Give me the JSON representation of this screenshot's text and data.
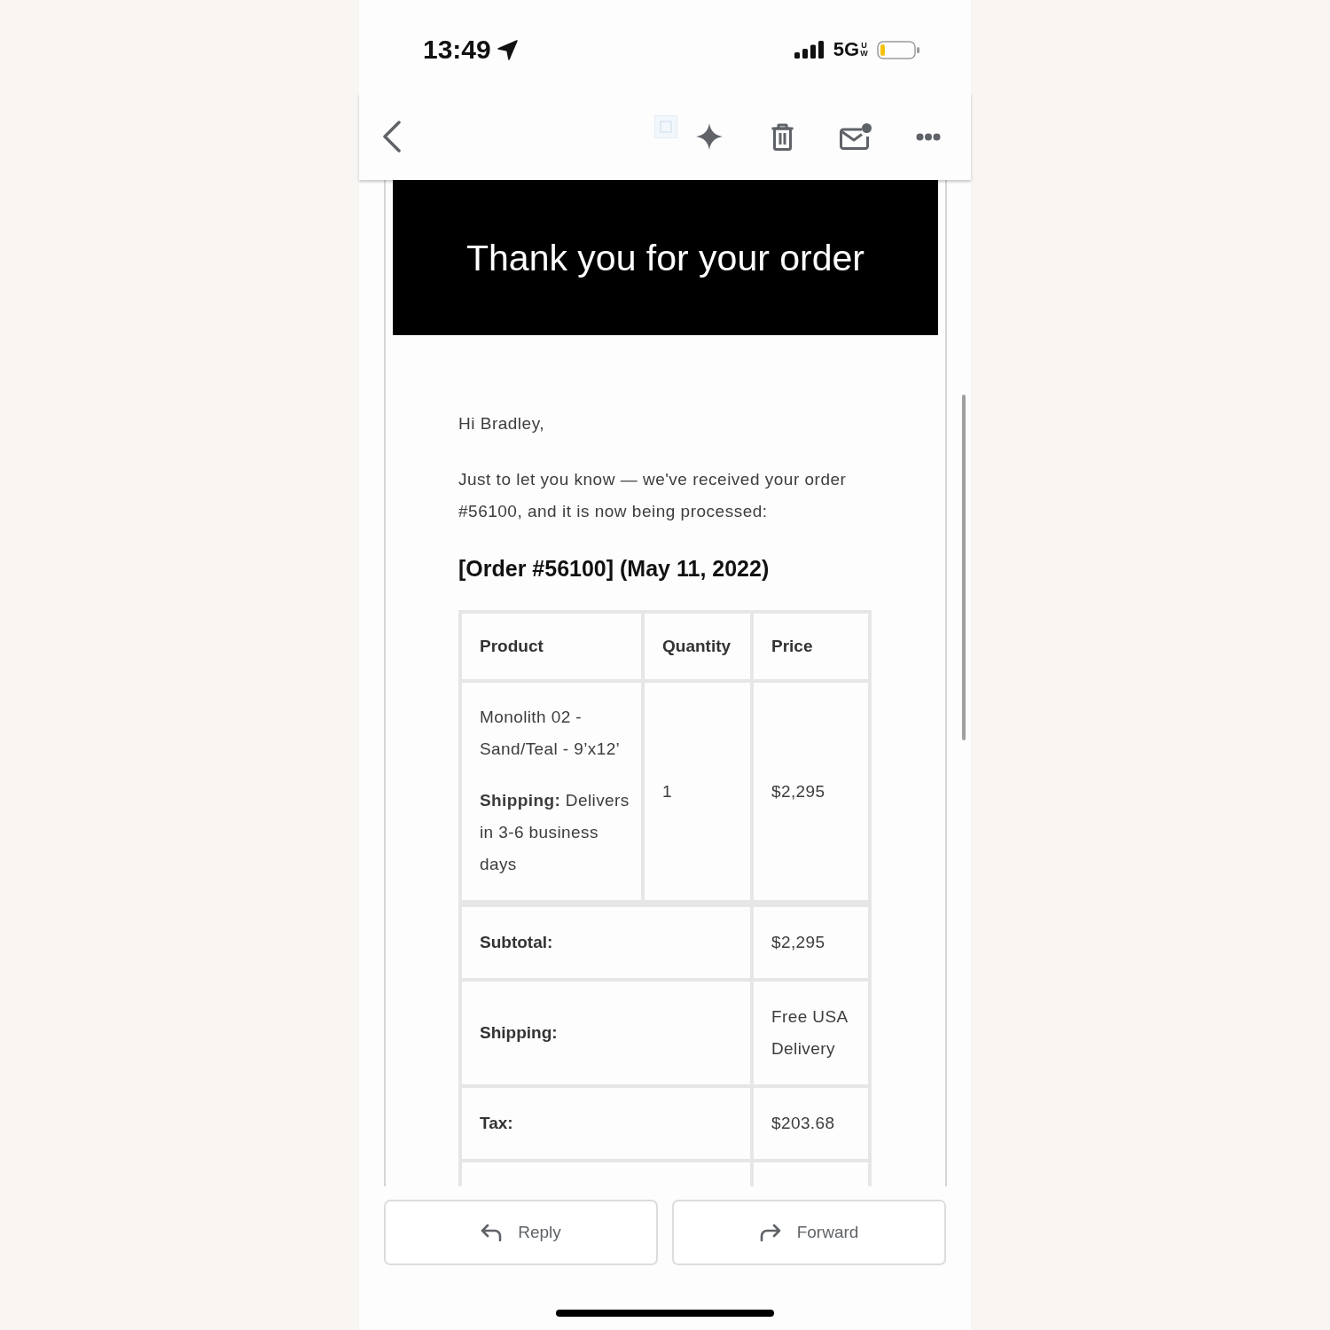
{
  "status_bar": {
    "time": "13:49",
    "network": "5G",
    "network_badge": "UW"
  },
  "email": {
    "banner_title": "Thank you for your order",
    "greeting": "Hi Bradley,",
    "message": "Just to let you know — we've received your order #56100, and it is now being processed:",
    "order_heading": "[Order #56100] (May 11, 2022)",
    "order_table": {
      "columns": [
        "Product",
        "Quantity",
        "Price"
      ],
      "rows": [
        {
          "product": "Monolith 02 - Sand/Teal - 9’x12’",
          "shipping_note": "**Shipping:** Delivers in 3-6 business days",
          "quantity": "1",
          "price": "$2,295"
        }
      ],
      "totals": [
        {
          "label": "Subtotal:",
          "value": "$2,295"
        },
        {
          "label": "Shipping:",
          "value": "Free USA Delivery"
        },
        {
          "label": "Tax:",
          "value": "$203.68"
        }
      ]
    }
  },
  "actions": [
    {
      "kind": "reply",
      "label": "Reply"
    },
    {
      "kind": "forward",
      "label": "Forward"
    }
  ]
}
